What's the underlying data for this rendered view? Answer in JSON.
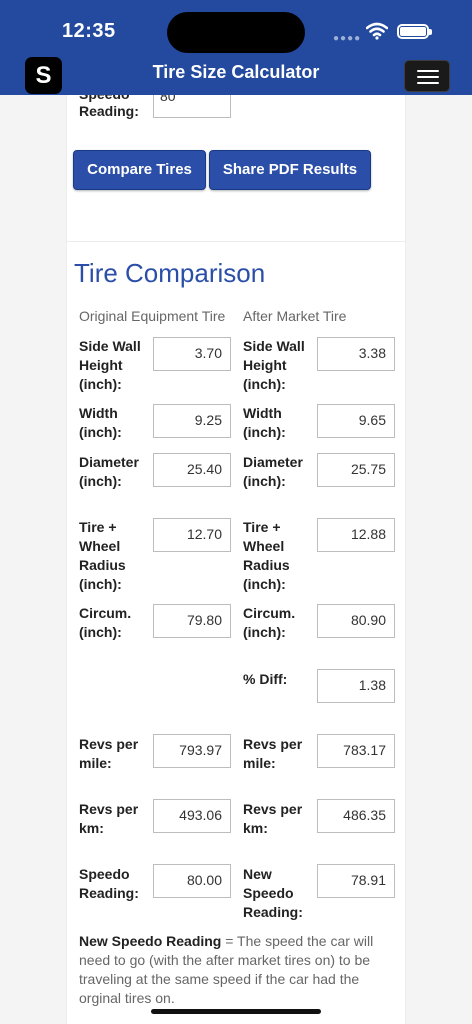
{
  "status": {
    "time": "12:35"
  },
  "header": {
    "logo": "S",
    "title": "Tire Size Calculator",
    "menu_icon": "hamburger-menu-icon"
  },
  "top_section": {
    "speedo_label_partial": "Speedo",
    "speedo_label": "Reading:",
    "speedo_value": "80",
    "compare_button": "Compare Tires",
    "share_button": "Share PDF Results"
  },
  "comparison": {
    "title": "Tire Comparison",
    "col_original": "Original Equipment Tire",
    "col_after": "After Market Tire",
    "rows": [
      {
        "left_label": "Side Wall Height (inch):",
        "left_value": "3.70",
        "right_label": "Side Wall Height (inch):",
        "right_value": "3.38"
      },
      {
        "left_label": "Width (inch):",
        "left_value": "9.25",
        "right_label": "Width (inch):",
        "right_value": "9.65"
      },
      {
        "left_label": "Diameter (inch):",
        "left_value": "25.40",
        "right_label": "Diameter (inch):",
        "right_value": "25.75"
      },
      {
        "left_label": "Tire + Wheel Radius (inch):",
        "left_value": "12.70",
        "right_label": "Tire + Wheel Radius (inch):",
        "right_value": "12.88"
      },
      {
        "left_label": "Circum. (inch):",
        "left_value": "79.80",
        "right_label": "Circum. (inch):",
        "right_value": "80.90"
      },
      {
        "right_label": "% Diff:",
        "right_value": "1.38"
      },
      {
        "left_label": "Revs per mile:",
        "left_value": "793.97",
        "right_label": "Revs per mile:",
        "right_value": "783.17"
      },
      {
        "left_label": "Revs per km:",
        "left_value": "493.06",
        "right_label": "Revs per km:",
        "right_value": "486.35"
      },
      {
        "left_label": "Speedo Reading:",
        "left_value": "80.00",
        "right_label": "New Speedo Reading:",
        "right_value": "78.91"
      }
    ],
    "note_bold": "New Speedo Reading",
    "note_text": " = The speed the car will need to go (with the after market tires on) to be traveling at the same speed if the car had the orginal tires on."
  }
}
